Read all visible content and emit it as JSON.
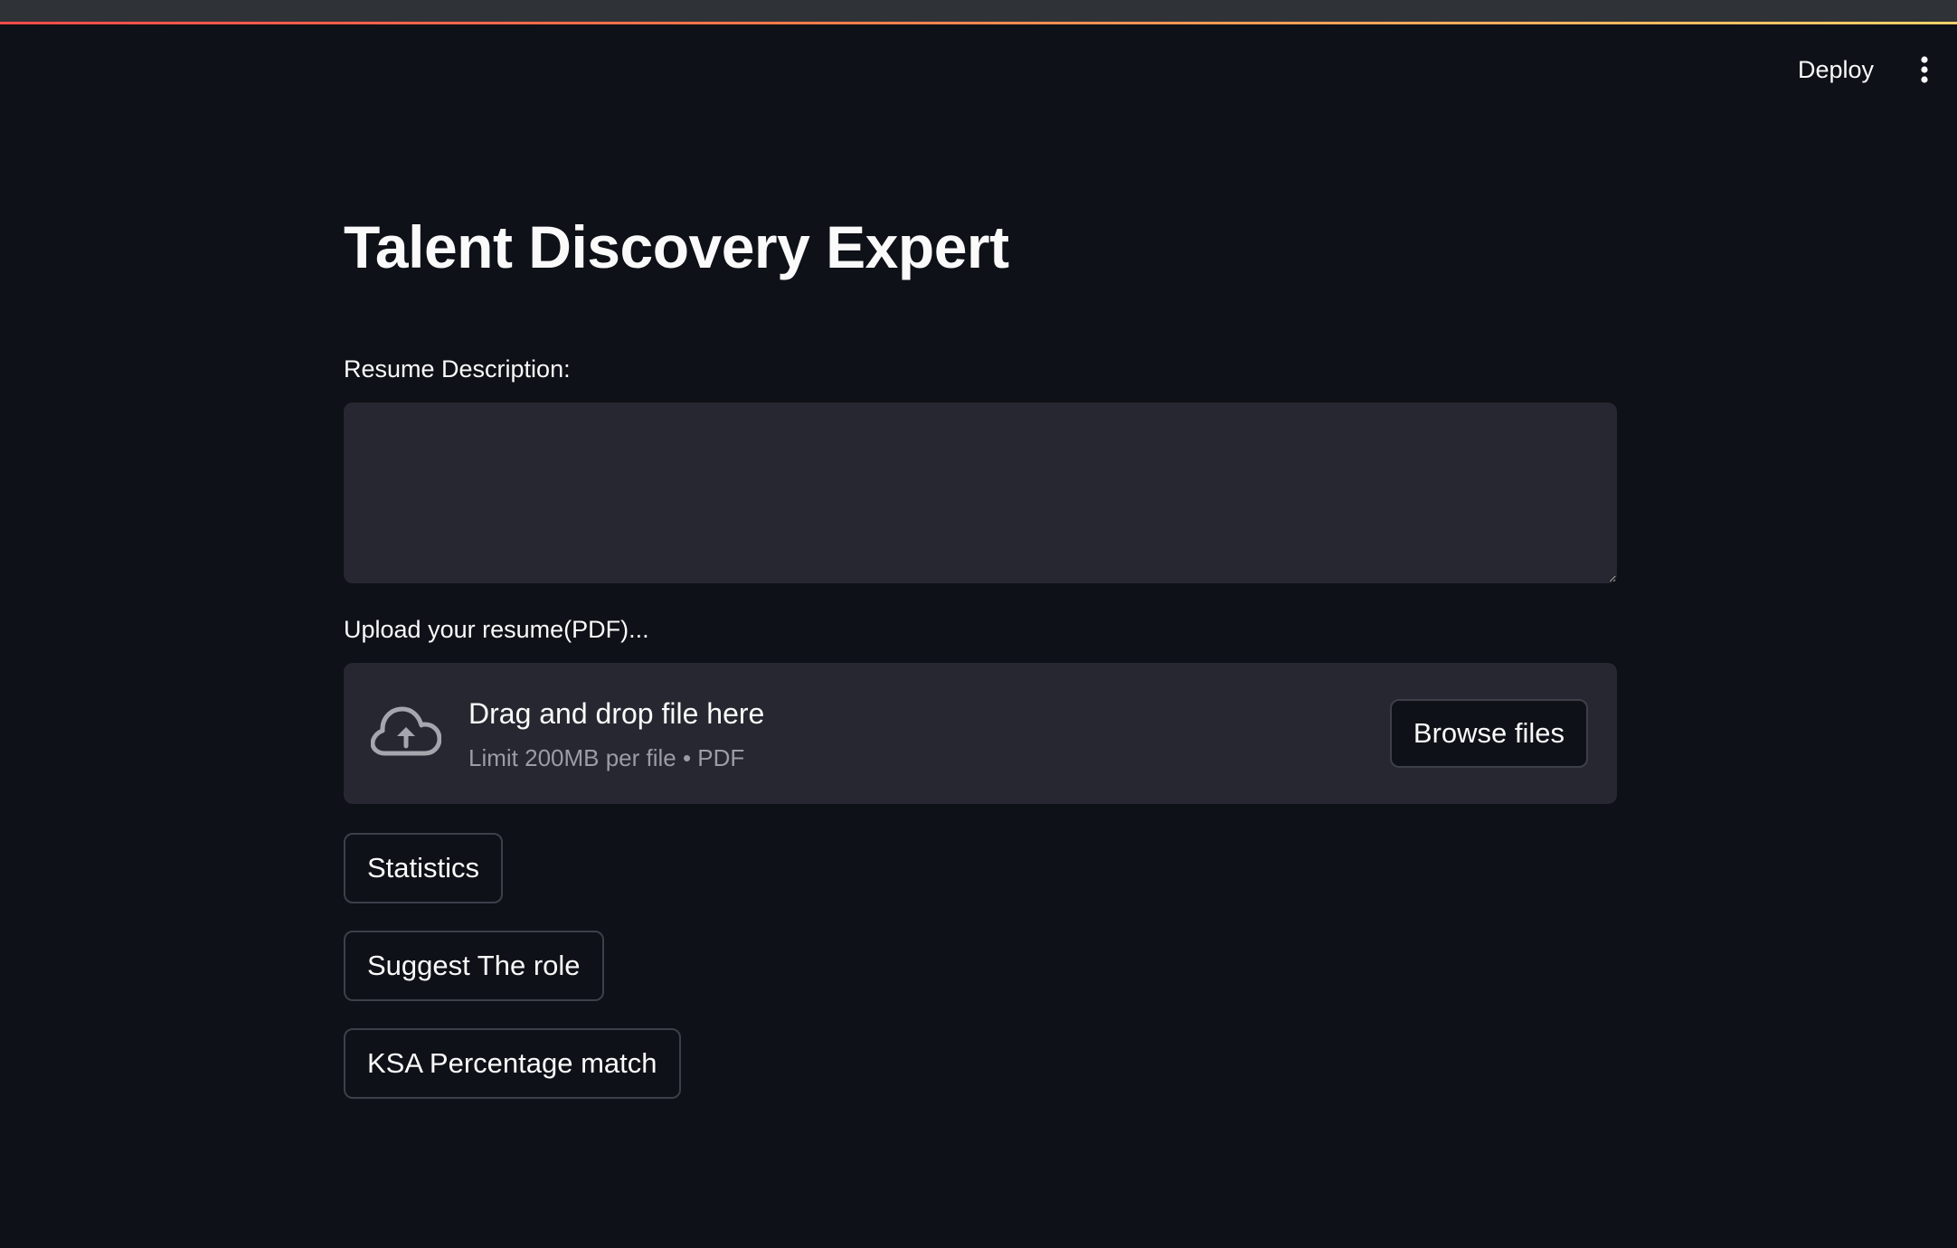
{
  "header": {
    "deploy_label": "Deploy",
    "menu_icon": "vertical-dots-icon"
  },
  "main": {
    "title": "Talent Discovery Expert",
    "resume_description": {
      "label": "Resume Description:",
      "value": "",
      "placeholder": ""
    },
    "upload": {
      "label": "Upload your resume(PDF)...",
      "dropzone_title": "Drag and drop file here",
      "dropzone_limit": "Limit 200MB per file • PDF",
      "browse_label": "Browse files",
      "icon": "cloud-upload-icon"
    },
    "buttons": {
      "statistics": "Statistics",
      "suggest_role": "Suggest The role",
      "ksa_match": "KSA Percentage match"
    }
  },
  "colors": {
    "background": "#0e1117",
    "surface": "#262730",
    "text": "#fafafa",
    "muted_text": "#9a9ca6",
    "border": "#3d4049",
    "accent_red": "#ff4b4b",
    "accent_yellow": "#ffd16a"
  }
}
